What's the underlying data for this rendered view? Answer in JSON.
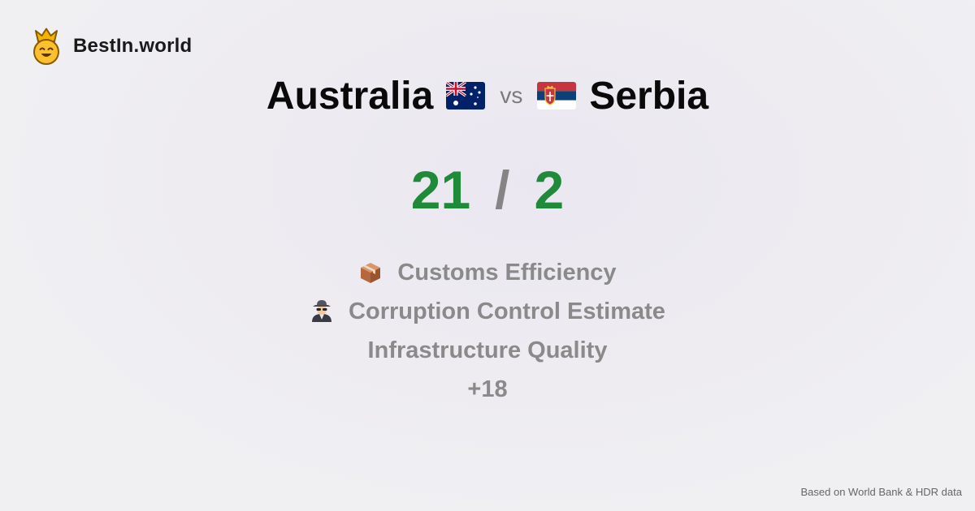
{
  "brand": {
    "name": "BestIn.world",
    "logo_icon": "crown-smiley-icon"
  },
  "comparison": {
    "country_a": {
      "name": "Australia",
      "flag_icon": "australia-flag-icon"
    },
    "vs_label": "vs",
    "country_b": {
      "name": "Serbia",
      "flag_icon": "serbia-flag-icon"
    },
    "score_a": "21",
    "separator": "/",
    "score_b": "2"
  },
  "features": [
    {
      "icon": "package-icon",
      "label": "Customs Efficiency"
    },
    {
      "icon": "spy-icon",
      "label": "Corruption Control Estimate"
    },
    {
      "icon": "",
      "label": "Infrastructure Quality"
    },
    {
      "icon": "",
      "label": "+18"
    }
  ],
  "footer": {
    "source": "Based on World Bank & HDR data"
  },
  "colors": {
    "score": "#1e8a3a",
    "muted": "#8a8a8a",
    "text": "#0a0a0a"
  }
}
